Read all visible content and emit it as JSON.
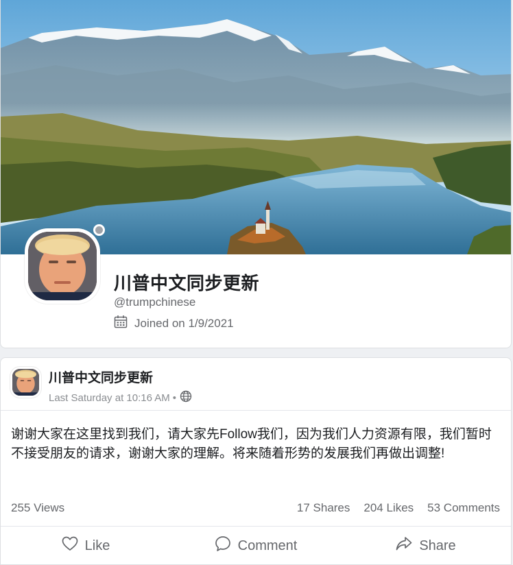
{
  "profile": {
    "name": "川普中文同步更新",
    "handle": "@trumpchinese",
    "joined": "Joined on 1/9/2021",
    "status_color": "#9ea2a8"
  },
  "post": {
    "author": "川普中文同步更新",
    "timestamp": "Last Saturday at 10:16 AM",
    "separator": "•",
    "visibility_icon": "globe-icon",
    "body": "谢谢大家在这里找到我们，请大家先Follow我们，因为我们人力资源有限，我们暂时不接受朋友的请求，谢谢大家的理解。将来随着形势的发展我们再做出调整!",
    "views": "255 Views",
    "shares": "17 Shares",
    "likes": "204 Likes",
    "comments": "53 Comments"
  },
  "actions": {
    "like_label": "Like",
    "comment_label": "Comment",
    "share_label": "Share"
  },
  "icons": {
    "calendar": "calendar-icon",
    "heart": "heart-icon",
    "comment": "comment-bubble-icon",
    "share": "share-arrow-icon"
  }
}
